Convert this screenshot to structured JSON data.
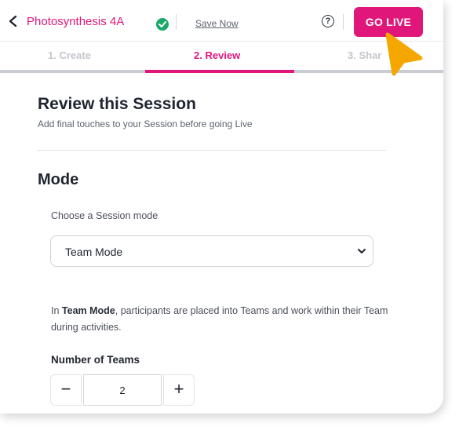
{
  "header": {
    "session_title": "Photosynthesis 4A",
    "save_now": "Save Now",
    "help_symbol": "?",
    "go_live": "GO LIVE"
  },
  "tabs": [
    {
      "label": "1. Create",
      "active": false
    },
    {
      "label": "2. Review",
      "active": true
    },
    {
      "label": "3. Shar",
      "active": false
    }
  ],
  "review": {
    "title": "Review this Session",
    "subtitle": "Add final touches to your Session before going Live"
  },
  "mode": {
    "title": "Mode",
    "choose_label": "Choose a Session mode",
    "selected": "Team Mode",
    "description_prefix": "In ",
    "description_bold": "Team Mode",
    "description_rest": ", participants are placed into Teams and work within their Team during activities.",
    "teams_label": "Number of Teams",
    "teams_minus": "−",
    "teams_value": "2",
    "teams_plus": "+"
  },
  "colors": {
    "accent": "#e0167a",
    "success": "#1aa86b",
    "cursor": "#f5a700"
  }
}
